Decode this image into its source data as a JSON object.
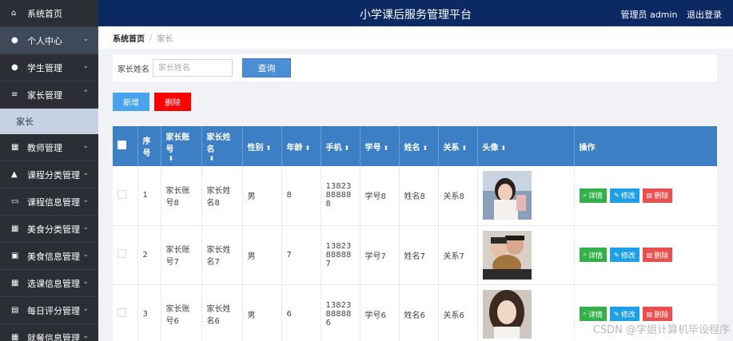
{
  "header": {
    "title": "小学课后服务管理平台",
    "user_label": "管理员 admin",
    "logout_label": "退出登录"
  },
  "sidebar": {
    "items": [
      {
        "label": "系统首页",
        "icon": "home-icon",
        "glyph": "⌂",
        "chevron": ""
      },
      {
        "label": "个人中心",
        "icon": "user-icon",
        "glyph": "●",
        "chevron": "⌄"
      },
      {
        "label": "学生管理",
        "icon": "user-icon",
        "glyph": "●",
        "chevron": "⌄"
      },
      {
        "label": "家长管理",
        "icon": "list-icon",
        "glyph": "≡",
        "chevron": "⌃"
      },
      {
        "label": "家长",
        "sub": true
      },
      {
        "label": "教师管理",
        "icon": "grid-icon",
        "glyph": "▦",
        "chevron": "⌄"
      },
      {
        "label": "课程分类管理",
        "icon": "thumb-icon",
        "glyph": "▲",
        "chevron": "⌄"
      },
      {
        "label": "课程信息管理",
        "icon": "monitor-icon",
        "glyph": "▭",
        "chevron": "⌄"
      },
      {
        "label": "美食分类管理",
        "icon": "grid-icon",
        "glyph": "▦",
        "chevron": "⌄"
      },
      {
        "label": "美食信息管理",
        "icon": "clipboard-icon",
        "glyph": "▣",
        "chevron": "⌄"
      },
      {
        "label": "选课信息管理",
        "icon": "grid-icon",
        "glyph": "▦",
        "chevron": "⌄"
      },
      {
        "label": "每日评分管理",
        "icon": "book-icon",
        "glyph": "▤",
        "chevron": "⌄"
      },
      {
        "label": "就餐信息管理",
        "icon": "grid-icon",
        "glyph": "▦",
        "chevron": "⌄"
      }
    ]
  },
  "breadcrumb": {
    "home": "系统首页",
    "separator": "/",
    "current": "家长"
  },
  "search": {
    "label": "家长姓名",
    "placeholder": "家长姓名",
    "value": "",
    "button": "查询"
  },
  "actions": {
    "add": "新增",
    "delete": "删除"
  },
  "table": {
    "columns": [
      "序号",
      "家长账号",
      "家长姓名",
      "性别",
      "年龄",
      "手机",
      "学号",
      "姓名",
      "关系",
      "头像",
      "操作"
    ],
    "sort_glyph": "⬍",
    "rows": [
      {
        "index": "1",
        "account": "家长账号8",
        "name": "家长姓名8",
        "gender": "男",
        "age": "8",
        "phone": "13823888888",
        "student_no": "学号8",
        "student_name": "姓名8",
        "relation": "关系8"
      },
      {
        "index": "2",
        "account": "家长账号7",
        "name": "家长姓名7",
        "gender": "男",
        "age": "7",
        "phone": "13823888887",
        "student_no": "学号7",
        "student_name": "姓名7",
        "relation": "关系7"
      },
      {
        "index": "3",
        "account": "家长账号6",
        "name": "家长姓名6",
        "gender": "男",
        "age": "6",
        "phone": "13823888886",
        "student_no": "学号6",
        "student_name": "姓名6",
        "relation": "关系6"
      }
    ],
    "row_actions": {
      "detail": "详情",
      "edit": "修改",
      "delete": "删除"
    }
  },
  "watermark": "CSDN @学姐计算机毕设程序",
  "colors": {
    "header_bg": "#0b2a63",
    "sidebar_bg": "#2b2f35",
    "table_header": "#3d7fc4",
    "detail": "#34b04a",
    "edit": "#1ea0e8",
    "delete": "#e8504f",
    "add": "#4aa3ee",
    "danger": "#ff0000"
  }
}
